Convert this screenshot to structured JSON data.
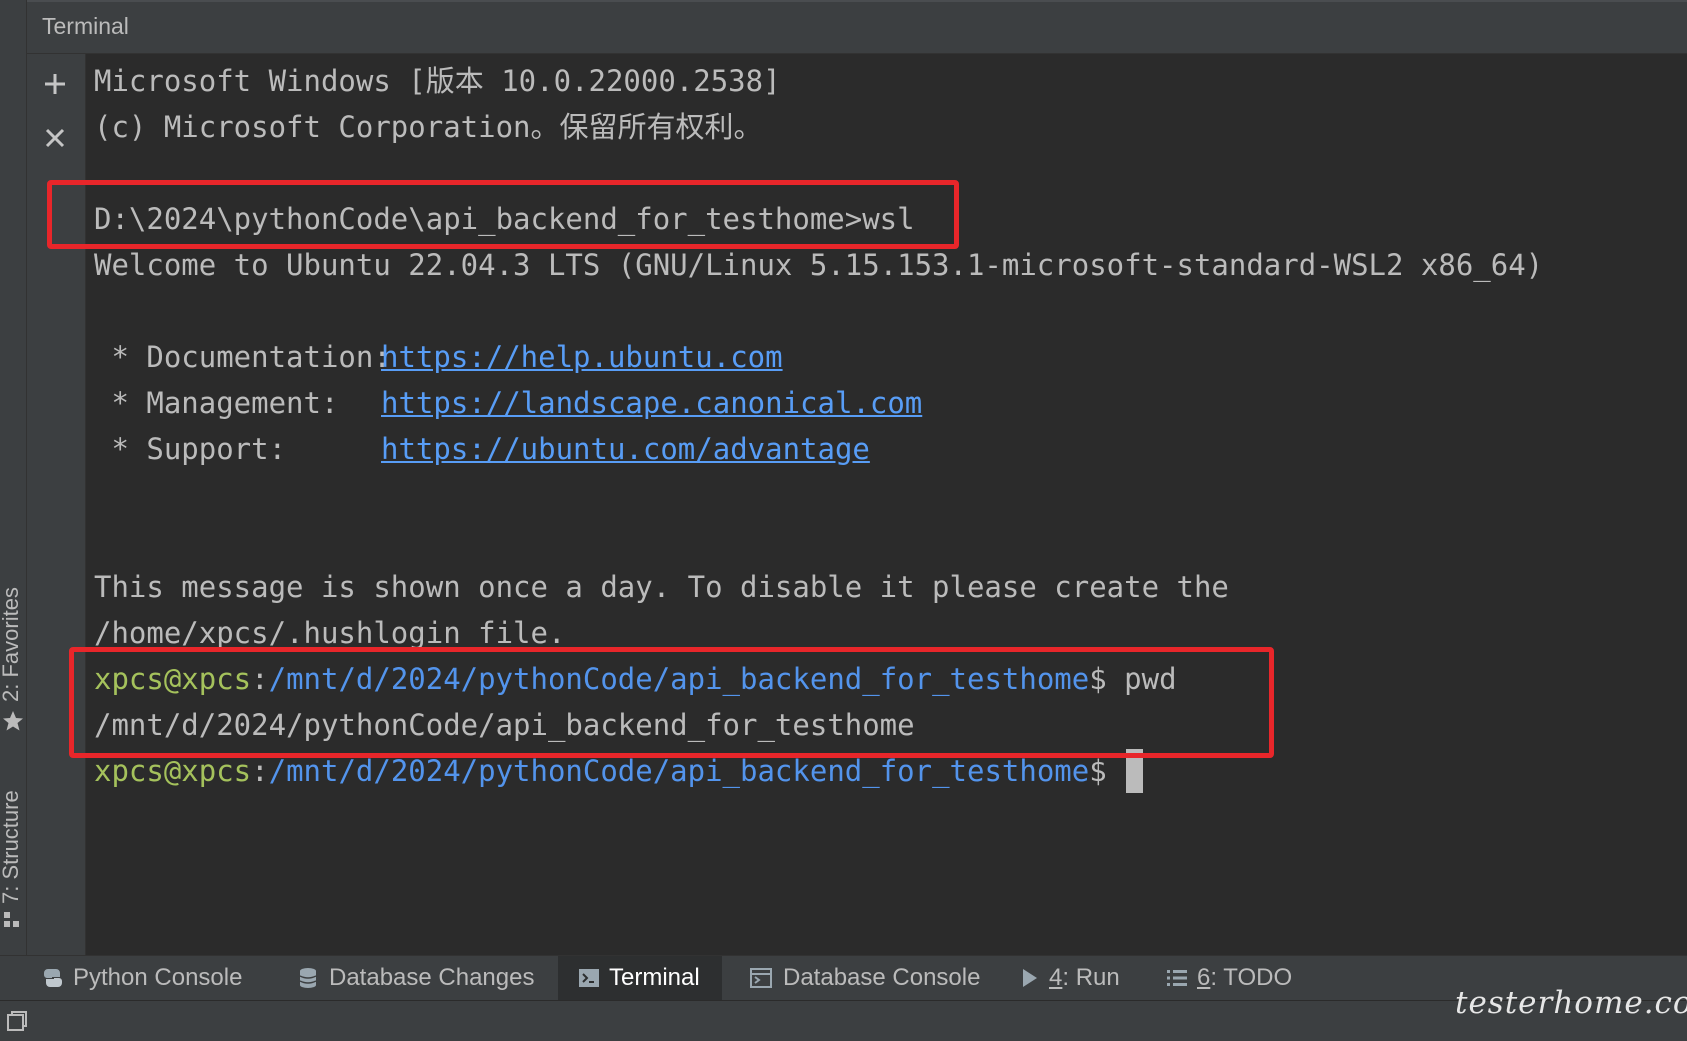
{
  "left_strip": {
    "favorites_label": "2: Favorites",
    "structure_label": "7: Structure",
    "favorites_icon": "star-icon",
    "structure_icon": "structure-icon"
  },
  "terminal": {
    "title": "Terminal",
    "add_icon": "plus-icon",
    "close_icon": "close-icon",
    "lines": {
      "l1": "Microsoft Windows [版本 10.0.22000.2538]",
      "l2": "(c) Microsoft Corporation。保留所有权利。",
      "l3": "D:\\2024\\pythonCode\\api_backend_for_testhome>wsl",
      "l4": "Welcome to Ubuntu 22.04.3 LTS (GNU/Linux 5.15.153.1-microsoft-standard-WSL2 x86_64)",
      "doc_label": " * Documentation:",
      "doc_url": "https://help.ubuntu.com",
      "mgmt_label": " * Management:",
      "mgmt_url": "https://landscape.canonical.com",
      "support_label": " * Support:",
      "support_url": "https://ubuntu.com/advantage",
      "msg1": "This message is shown once a day. To disable it please create the",
      "msg2": "/home/xpcs/.hushlogin file.",
      "prompt_user": "xpcs@xpcs",
      "prompt_sep": ":",
      "prompt_path": "/mnt/d/2024/pythonCode/api_backend_for_testhome",
      "prompt_dollar": "$",
      "cmd_pwd": " pwd",
      "pwd_output": "/mnt/d/2024/pythonCode/api_backend_for_testhome"
    },
    "colors": {
      "prompt_user": "#a5c25c",
      "prompt_path": "#5394ec",
      "link": "#589df6",
      "highlight": "#e8262a"
    }
  },
  "bottom_tabs": {
    "python_console": "Python Console",
    "database_changes": "Database Changes",
    "terminal": "Terminal",
    "database_console": "Database Console",
    "run_num": "4",
    "run_label": ": Run",
    "todo_num": "6",
    "todo_label": ": TODO"
  },
  "watermark": "testerhome.com"
}
